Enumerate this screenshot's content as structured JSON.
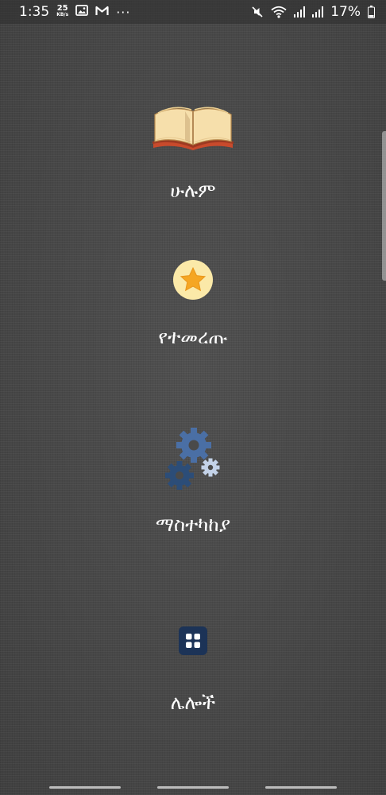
{
  "status_bar": {
    "time": "1:35",
    "speed_value": "25",
    "speed_unit": "KB/s",
    "more": "···",
    "battery_percent": "17%",
    "left_icons": [
      "image-icon",
      "gmail-icon"
    ],
    "right_icons": [
      "mute-icon",
      "wifi-icon",
      "signal-icon",
      "signal-icon",
      "battery-icon"
    ]
  },
  "menu": {
    "items": [
      {
        "label": "ሁሉም",
        "icon": "book-icon"
      },
      {
        "label": "የተመረጡ",
        "icon": "star-icon"
      },
      {
        "label": "ማስተካከያ",
        "icon": "gears-icon"
      },
      {
        "label": "ሌሎች",
        "icon": "apps-grid-icon"
      }
    ]
  },
  "colors": {
    "background": "#4a4a4a",
    "star_circle": "#fbe9a8",
    "star": "#f5a623",
    "gear_dark": "#2c4d78",
    "gear_mid": "#4a6fa5",
    "gear_light": "#c3d2e8",
    "apps_tile": "#1c3357",
    "book_cover": "#c84a2c",
    "book_pages": "#f6dfab"
  }
}
